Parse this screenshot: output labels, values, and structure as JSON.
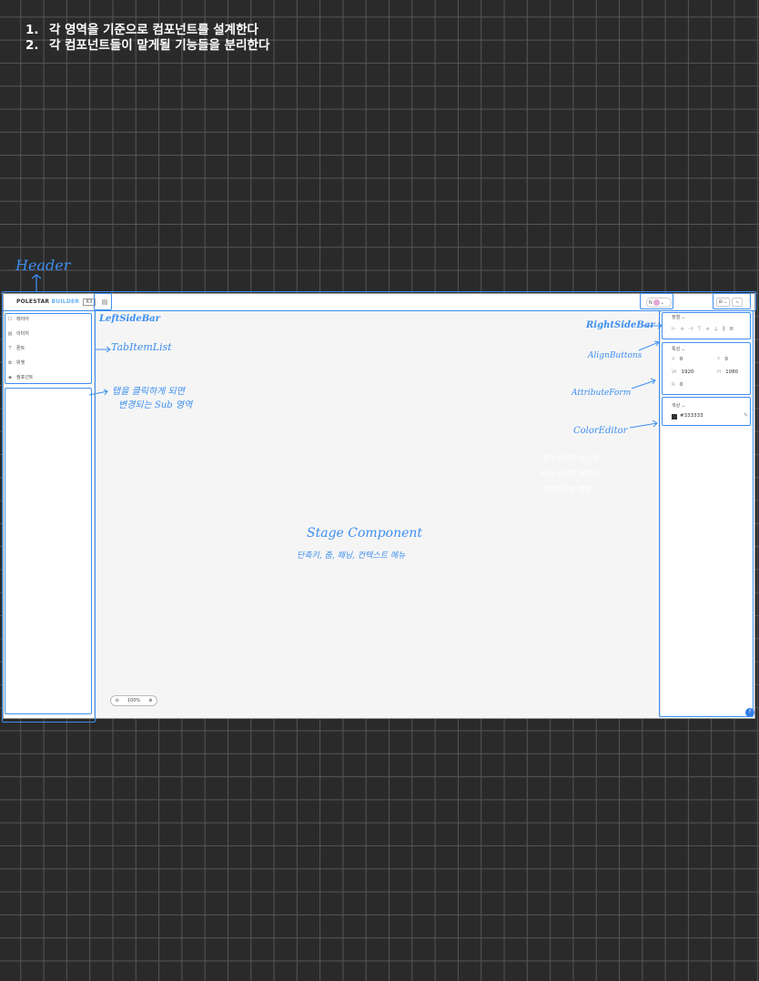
{
  "notes": [
    {
      "num": "1.",
      "text": "각 영역을 기준으로 컴포넌트를 설계한다"
    },
    {
      "num": "2.",
      "text": "각 컴포넌트들이 맡게될 기능들을 분리한다"
    }
  ],
  "annotations": {
    "header": "Header",
    "left_sidebar": "LeftSideBar",
    "tab_item_list": "TabItemList",
    "sub_area_line1": "탭을 클릭하게 되면",
    "sub_area_line2": "변경되는 Sub 영역",
    "right_sidebar": "RightSideBar",
    "align_buttons": "AlignButtons",
    "attribute_form": "AttributeForm",
    "color_editor": "ColorEditor",
    "selection_note_line1": "내가 선택한 노드에",
    "selection_note_line2": "따라 오른쪽 영역이",
    "selection_note_line3": "가변적으로 변함 !",
    "stage_component": "Stage Component",
    "stage_features": "단축키, 줌, 패닝, 컨텍스트 메뉴"
  },
  "header": {
    "brand_a": "POLESTAR",
    "brand_b": "BUILDER",
    "version": "R3",
    "toggle_icon": "▤",
    "user_initial": "N",
    "user_chevron": "⌄",
    "btn_a": "⊞ ⌄",
    "btn_b": "⤷",
    "more": "⋮"
  },
  "left_sidebar": {
    "tabs": [
      {
        "icon": "layers-icon",
        "glyph": "☐",
        "label": "레이어"
      },
      {
        "icon": "image-icon",
        "glyph": "▨",
        "label": "이미지"
      },
      {
        "icon": "text-icon",
        "glyph": "T",
        "label": "폰트"
      },
      {
        "icon": "widget-icon",
        "glyph": "✿",
        "label": "위젯"
      },
      {
        "icon": "component-icon",
        "glyph": "◆",
        "label": "컴포넌트"
      }
    ]
  },
  "right_sidebar": {
    "align_label": "정렬 ⌄",
    "align_buttons": [
      "⊢",
      "⟡",
      "⊣",
      "⊤",
      "⟡",
      "⊥",
      "⫼",
      "≣"
    ],
    "attr_label": "특성 ⌄",
    "attrs": [
      {
        "pre": "X",
        "value": "0"
      },
      {
        "pre": "Y",
        "value": "0"
      },
      {
        "pre": "W",
        "value": "1920"
      },
      {
        "pre": "H",
        "value": "1080"
      },
      {
        "pre": "R",
        "value": "0"
      }
    ],
    "color_label": "색상 ⌄",
    "color_value": "#333333",
    "eyedropper": "✎",
    "help": "?"
  },
  "zoom": {
    "out": "⊖",
    "level": "100%",
    "in": "⊕"
  },
  "colors": {
    "annotation_blue": "#3d8ef0",
    "grid_bg": "#2a2a2a",
    "swatch": "#333333"
  }
}
